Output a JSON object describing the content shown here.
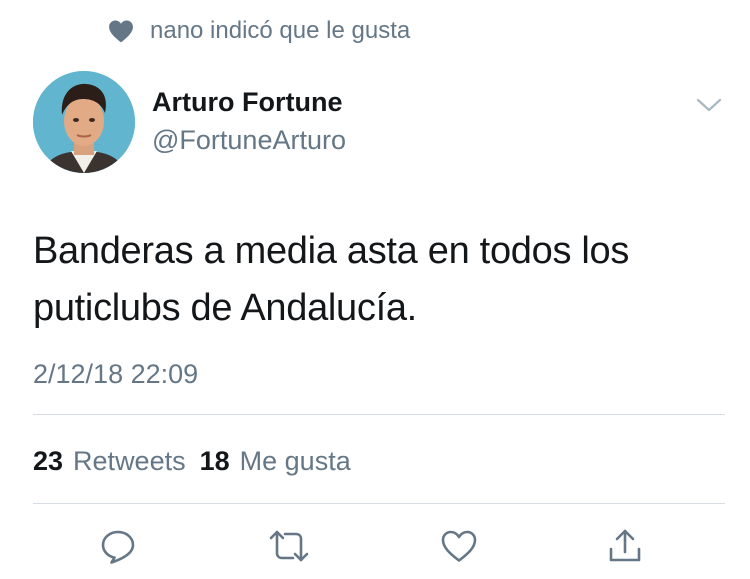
{
  "social_context": {
    "icon": "heart-icon",
    "text": "nano indicó que le gusta"
  },
  "author": {
    "name": "Arturo Fortune",
    "handle": "@FortuneArturo"
  },
  "tweet": {
    "text": "Banderas a media asta en todos los puticlubs de Andalucía.",
    "timestamp": "2/12/18 22:09"
  },
  "stats": {
    "retweets_count": "23",
    "retweets_label": "Retweets",
    "likes_count": "18",
    "likes_label": "Me gusta"
  },
  "actions": [
    {
      "name": "reply",
      "icon": "reply-icon"
    },
    {
      "name": "retweet",
      "icon": "retweet-icon"
    },
    {
      "name": "like",
      "icon": "heart-icon"
    },
    {
      "name": "share",
      "icon": "share-icon"
    }
  ],
  "colors": {
    "text_primary": "#14171a",
    "text_secondary": "#657786",
    "icon_gray": "#657786",
    "divider": "#d6dce1",
    "avatar_background": "#61b5cf"
  }
}
